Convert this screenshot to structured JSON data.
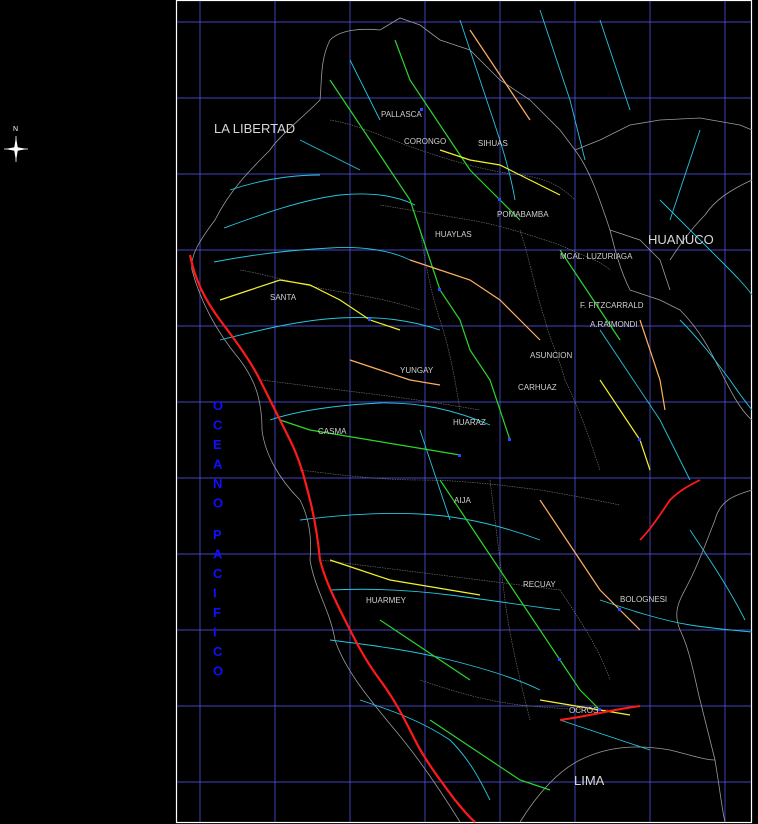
{
  "compass": {
    "north_label": "N"
  },
  "regions": {
    "la_libertad": "LA LIBERTAD",
    "huanuco": "HUANUCO",
    "lima": "LIMA"
  },
  "ocean": {
    "letters": [
      "O",
      "C",
      "E",
      "A",
      "N",
      "O",
      "P",
      "A",
      "C",
      "I",
      "F",
      "I",
      "C",
      "O"
    ]
  },
  "provinces": {
    "pallasca": "PALLASCA",
    "corongo": "CORONGO",
    "sihuas": "SIHUAS",
    "pomabamba": "POMABAMBA",
    "huaylas": "HUAYLAS",
    "mcal_luzuriaga": "MCAL. LUZURIAGA",
    "santa": "SANTA",
    "f_fitzcarrald": "F. FITZCARRALD",
    "a_raimondi": "A.RAIMONDI",
    "asuncion": "ASUNCION",
    "yungay": "YUNGAY",
    "carhuaz": "CARHUAZ",
    "casma": "CASMA",
    "huaraz": "HUARAZ",
    "aija": "AIJA",
    "recuay": "RECUAY",
    "huarmey": "HUARMEY",
    "bolognesi": "BOLOGNESI",
    "ocros": "OCROS"
  },
  "colors": {
    "background": "#000000",
    "grid": "#5a5aff",
    "frame": "#ffffff",
    "boundary": "#9a9a9a",
    "rivers": "#27c6e0",
    "highway": "#ff1a1a",
    "roads_green": "#2bd62b",
    "roads_yellow": "#f2f22a",
    "roads_orange": "#ffb060",
    "roads_blue": "#2a4aff",
    "ocean_text": "#1010ff"
  }
}
